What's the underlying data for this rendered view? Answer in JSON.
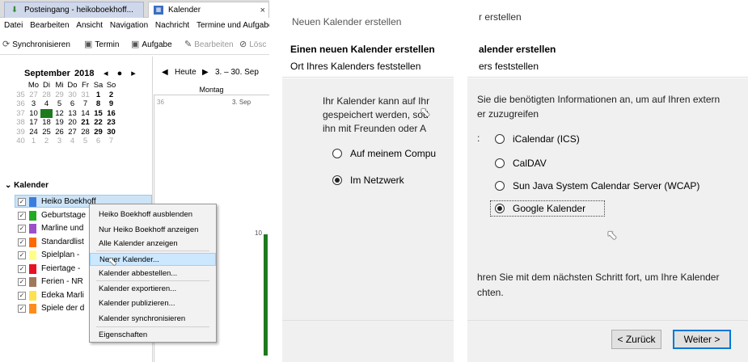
{
  "thunderbird": {
    "tabs": [
      {
        "label": "Posteingang - heikoboekhoff...",
        "icon": "inbox-icon"
      },
      {
        "label": "Kalender",
        "icon": "calendar-icon",
        "close": "×"
      }
    ],
    "menu": [
      "Datei",
      "Bearbeiten",
      "Ansicht",
      "Navigation",
      "Nachricht",
      "Termine und Aufgaben"
    ],
    "toolbar": {
      "sync": "Synchronisieren",
      "event": "Termin",
      "task": "Aufgabe",
      "edit": "Bearbeiten",
      "delete": "Lösc"
    },
    "minical": {
      "month": "September",
      "year": "2018",
      "nav": "◂ ● ▸",
      "weekdays": [
        "Mo",
        "Di",
        "Mi",
        "Do",
        "Fr",
        "Sa",
        "So"
      ],
      "weeks": [
        {
          "wk": "35",
          "days": [
            "27",
            "28",
            "29",
            "30",
            "31",
            "1",
            "2"
          ]
        },
        {
          "wk": "36",
          "days": [
            "3",
            "4",
            "5",
            "6",
            "7",
            "8",
            "9"
          ]
        },
        {
          "wk": "37",
          "days": [
            "10",
            "11",
            "12",
            "13",
            "14",
            "15",
            "16"
          ]
        },
        {
          "wk": "38",
          "days": [
            "17",
            "18",
            "19",
            "20",
            "21",
            "22",
            "23"
          ]
        },
        {
          "wk": "39",
          "days": [
            "24",
            "25",
            "26",
            "27",
            "28",
            "29",
            "30"
          ]
        },
        {
          "wk": "40",
          "days": [
            "1",
            "2",
            "3",
            "4",
            "5",
            "6",
            "7"
          ]
        }
      ]
    },
    "calview": {
      "today": "Heute",
      "range": "3. – 30. Sep",
      "col": "Montag",
      "wk": "36",
      "date": "3. Sep",
      "slot": "10"
    },
    "calendars_title": "Kalender",
    "calendars": [
      {
        "name": "Heiko Boekhoff",
        "color": "#3b7ddd"
      },
      {
        "name": "Geburtstage",
        "color": "#22aa22"
      },
      {
        "name": "Marline und",
        "color": "#9b4fc9"
      },
      {
        "name": "Standardlist",
        "color": "#ff6a00"
      },
      {
        "name": "Spielplan -",
        "color": "#ffff88"
      },
      {
        "name": "Feiertage -",
        "color": "#e81123"
      },
      {
        "name": "Ferien - NR",
        "color": "#a0785a"
      },
      {
        "name": "Edeka Marli",
        "color": "#ffe14d"
      },
      {
        "name": "Spiele der d",
        "color": "#ff8c1a"
      }
    ],
    "context_menu": [
      "Heiko Boekhoff ausblenden",
      "Nur Heiko Boekhoff anzeigen",
      "Alle Kalender anzeigen",
      "Neuer Kalender...",
      "Kalender abbestellen...",
      "Kalender exportieren...",
      "Kalender publizieren...",
      "Kalender synchronisieren",
      "Eigenschaften"
    ]
  },
  "wizard1": {
    "title": "Neuen Kalender erstellen",
    "heading": "Einen neuen Kalender erstellen",
    "subheading": "Ort Ihres Kalenders feststellen",
    "para": [
      "Ihr Kalender kann auf Ihr",
      "gespeichert werden, sod",
      "ihn mit Freunden oder A"
    ],
    "options": [
      "Auf meinem Compu",
      "Im Netzwerk"
    ]
  },
  "wizard2": {
    "title": "r erstellen",
    "heading": "alender erstellen",
    "subheading": "ers feststellen",
    "para": [
      "Sie die benötigten Informationen an, um auf Ihren extern",
      "er zuzugreifen"
    ],
    "colon": ":",
    "options": [
      "iCalendar (ICS)",
      "CalDAV",
      "Sun Java System Calendar Server (WCAP)",
      "Google Kalender"
    ],
    "footer": [
      "hren Sie mit dem nächsten Schritt fort, um Ihre Kalender",
      "chten."
    ],
    "back": "< Zurück",
    "next": "Weiter >"
  }
}
